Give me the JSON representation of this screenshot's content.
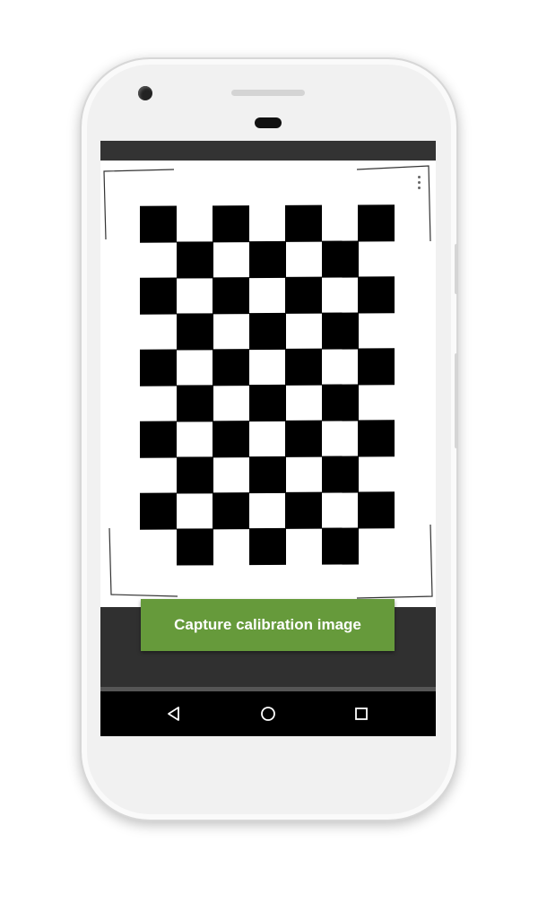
{
  "app": {
    "capture_button_label": "Capture calibration image"
  },
  "calibration_target": {
    "pattern": "checkerboard",
    "rows": 10,
    "columns": 7
  },
  "navigation": {
    "buttons": [
      "back-icon",
      "home-icon",
      "recents-icon"
    ]
  },
  "colors": {
    "accent_green": "#669a3b",
    "screen_dark": "#2f2f2f",
    "nav_bar": "#000000",
    "phone_body": "#f1f1f1"
  }
}
